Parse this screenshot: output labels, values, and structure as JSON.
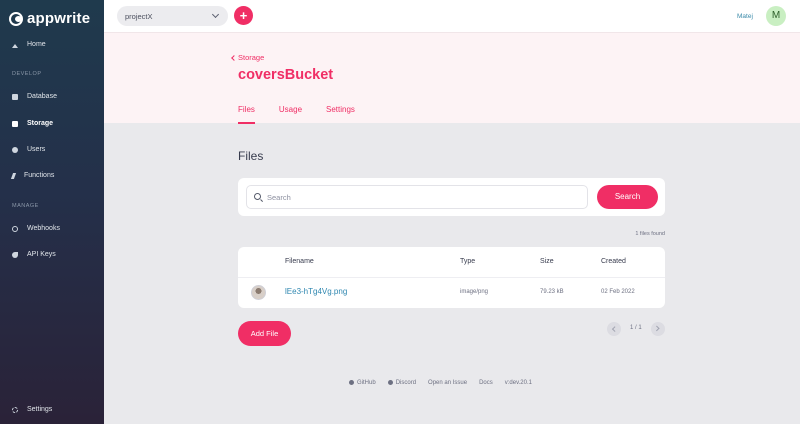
{
  "app": {
    "logo_text": "appwrite"
  },
  "sidebar": {
    "items": [
      {
        "label": "Home",
        "icon": "home-icon"
      },
      {
        "label": "Database",
        "icon": "database-icon"
      },
      {
        "label": "Storage",
        "icon": "folder-icon"
      },
      {
        "label": "Users",
        "icon": "users-icon"
      },
      {
        "label": "Functions",
        "icon": "bolt-icon"
      },
      {
        "label": "Webhooks",
        "icon": "webhook-icon"
      },
      {
        "label": "API Keys",
        "icon": "key-icon"
      },
      {
        "label": "Settings",
        "icon": "gear-icon"
      }
    ],
    "sections": {
      "develop": "DEVELOP",
      "manage": "MANAGE"
    }
  },
  "topbar": {
    "project": "projectX",
    "add_label": "+",
    "user_name": "Matej",
    "avatar_initial": "M"
  },
  "header": {
    "back_label": "Storage",
    "title": "coversBucket",
    "tabs": [
      {
        "label": "Files"
      },
      {
        "label": "Usage"
      },
      {
        "label": "Settings"
      }
    ]
  },
  "main": {
    "section_title": "Files",
    "search": {
      "placeholder": "Search",
      "button": "Search"
    },
    "files_found": "1 files found",
    "table": {
      "columns": [
        "Filename",
        "Type",
        "Size",
        "Created"
      ],
      "rows": [
        {
          "filename": "lEe3-hTg4Vg.png",
          "type": "image/png",
          "size": "79.23 kB",
          "created": "02 Feb 2022"
        }
      ]
    },
    "add_file": "Add File",
    "pagination": "1 / 1"
  },
  "footer": {
    "links": [
      "GitHub",
      "Discord",
      "Open an Issue",
      "Docs",
      "v:dev.20.1"
    ]
  },
  "colors": {
    "accent": "#f02e65",
    "link": "#2f87b0"
  }
}
